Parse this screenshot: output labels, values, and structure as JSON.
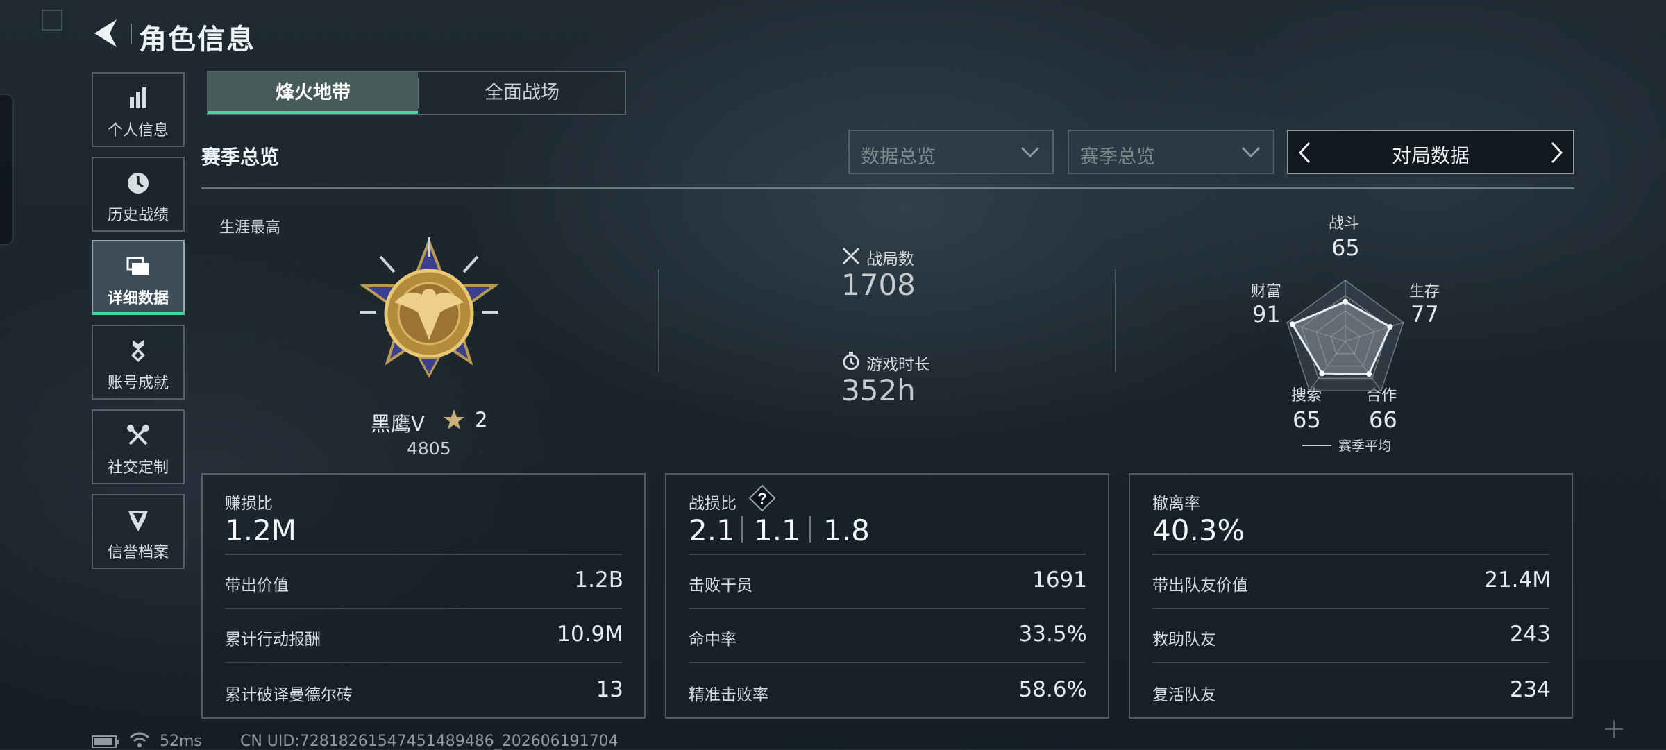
{
  "header": {
    "title": "角色信息"
  },
  "sidebar": {
    "items": [
      {
        "label": "个人信息",
        "icon": "bar-chart-icon"
      },
      {
        "label": "历史战绩",
        "icon": "history-icon"
      },
      {
        "label": "详细数据",
        "icon": "folder-icon",
        "active": true
      },
      {
        "label": "账号成就",
        "icon": "achievement-icon"
      },
      {
        "label": "社交定制",
        "icon": "tools-icon"
      },
      {
        "label": "信誉档案",
        "icon": "reputation-icon"
      }
    ]
  },
  "tabs": [
    {
      "label": "烽火地带",
      "active": true
    },
    {
      "label": "全面战场",
      "active": false
    }
  ],
  "section_title": "赛季总览",
  "filters": {
    "data_dropdown": "数据总览",
    "season_dropdown": "赛季总览",
    "match_selector": "对局数据"
  },
  "career": {
    "label": "生涯最高",
    "rank_name": "黑鹰Ⅴ",
    "stars": "2",
    "score": "4805"
  },
  "stats": {
    "battles": {
      "label": "战局数",
      "value": "1708"
    },
    "playtime": {
      "label": "游戏时长",
      "value": "352h"
    }
  },
  "radar": {
    "axes": [
      {
        "label": "战斗",
        "value": 65
      },
      {
        "label": "生存",
        "value": 77
      },
      {
        "label": "合作",
        "value": 66
      },
      {
        "label": "搜索",
        "value": 65
      },
      {
        "label": "财富",
        "value": 91
      }
    ],
    "max": 100,
    "legend": "赛季平均"
  },
  "cards": {
    "profit": {
      "title": "赚损比",
      "value": "1.2M",
      "rows": [
        {
          "label": "带出价值",
          "value": "1.2B"
        },
        {
          "label": "累计行动报酬",
          "value": "10.9M"
        },
        {
          "label": "累计破译曼德尔砖",
          "value": "13"
        }
      ]
    },
    "kd": {
      "title": "战损比",
      "help": "?",
      "values": [
        "2.1",
        "1.1",
        "1.8"
      ],
      "rows": [
        {
          "label": "击败干员",
          "value": "1691"
        },
        {
          "label": "命中率",
          "value": "33.5%"
        },
        {
          "label": "精准击败率",
          "value": "58.6%"
        }
      ]
    },
    "extract": {
      "title": "撤离率",
      "value": "40.3%",
      "rows": [
        {
          "label": "带出队友价值",
          "value": "21.4M"
        },
        {
          "label": "救助队友",
          "value": "243"
        },
        {
          "label": "复活队友",
          "value": "234"
        }
      ]
    }
  },
  "footer": {
    "ping": "52ms",
    "uid": "CN UID:7281826154745148948​6_202606191704"
  },
  "colors": {
    "accent": "#3fd99a"
  }
}
